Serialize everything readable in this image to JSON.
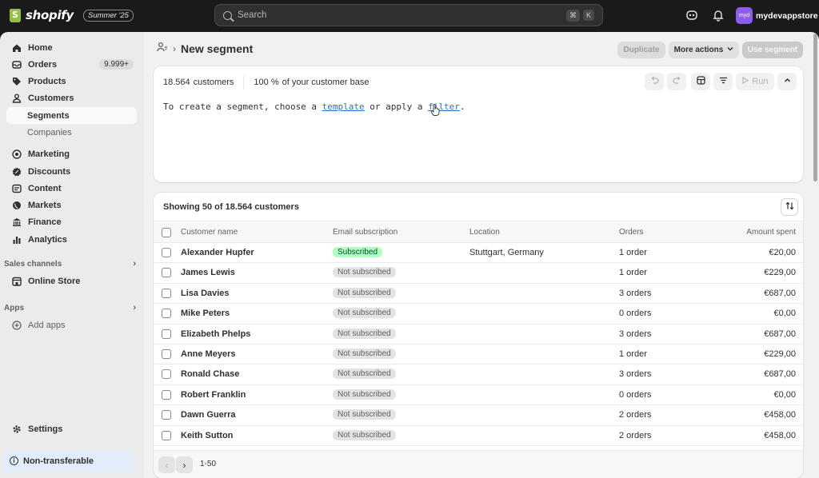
{
  "topbar": {
    "logo_text": "shopify",
    "edition_badge": "Summer '25",
    "search_placeholder": "Search",
    "shortcut_keys": [
      "⌘",
      "K"
    ],
    "store_avatar": "myd",
    "store_name": "mydevappstore"
  },
  "sidebar": {
    "items": [
      {
        "label": "Home",
        "icon": "home-icon"
      },
      {
        "label": "Orders",
        "icon": "orders-icon",
        "count": "9.999+"
      },
      {
        "label": "Products",
        "icon": "tag-icon"
      },
      {
        "label": "Customers",
        "icon": "person-icon"
      },
      {
        "label": "Segments",
        "sub": true,
        "active": true
      },
      {
        "label": "Companies",
        "sub": true
      },
      {
        "label": "Marketing",
        "icon": "target-icon"
      },
      {
        "label": "Discounts",
        "icon": "discount-icon"
      },
      {
        "label": "Content",
        "icon": "content-icon"
      },
      {
        "label": "Markets",
        "icon": "globe-icon"
      },
      {
        "label": "Finance",
        "icon": "bank-icon"
      },
      {
        "label": "Analytics",
        "icon": "chart-icon"
      }
    ],
    "sales_channels_label": "Sales channels",
    "online_store_label": "Online Store",
    "apps_label": "Apps",
    "add_apps_label": "Add apps",
    "settings_label": "Settings",
    "non_transferable_label": "Non-transferable"
  },
  "page": {
    "title": "New segment",
    "buttons": {
      "duplicate": "Duplicate",
      "more_actions": "More actions",
      "use_segment": "Use segment"
    }
  },
  "editor": {
    "customer_count": "18.564",
    "customer_count_suffix": "customers",
    "base_percent": "100 %",
    "base_suffix": "of your customer base",
    "run_label": "Run",
    "text_prefix": "To create a segment, choose a",
    "template_link": "template",
    "text_middle": "or apply a",
    "filter_link": "filter",
    "text_suffix": "."
  },
  "table": {
    "title": "Showing 50 of 18.564 customers",
    "columns": [
      "Customer name",
      "Email subscription",
      "Location",
      "Orders",
      "Amount spent"
    ],
    "rows": [
      {
        "name": "Alexander Hupfer",
        "subscription": "Subscribed",
        "location": "Stuttgart, Germany",
        "orders": "1 order",
        "amount": "€20,00"
      },
      {
        "name": "James Lewis",
        "subscription": "Not subscribed",
        "location": "",
        "orders": "1 order",
        "amount": "€229,00"
      },
      {
        "name": "Lisa Davies",
        "subscription": "Not subscribed",
        "location": "",
        "orders": "3 orders",
        "amount": "€687,00"
      },
      {
        "name": "Mike Peters",
        "subscription": "Not subscribed",
        "location": "",
        "orders": "0 orders",
        "amount": "€0,00"
      },
      {
        "name": "Elizabeth Phelps",
        "subscription": "Not subscribed",
        "location": "",
        "orders": "3 orders",
        "amount": "€687,00"
      },
      {
        "name": "Anne Meyers",
        "subscription": "Not subscribed",
        "location": "",
        "orders": "1 order",
        "amount": "€229,00"
      },
      {
        "name": "Ronald Chase",
        "subscription": "Not subscribed",
        "location": "",
        "orders": "3 orders",
        "amount": "€687,00"
      },
      {
        "name": "Robert Franklin",
        "subscription": "Not subscribed",
        "location": "",
        "orders": "0 orders",
        "amount": "€0,00"
      },
      {
        "name": "Dawn Guerra",
        "subscription": "Not subscribed",
        "location": "",
        "orders": "2 orders",
        "amount": "€458,00"
      },
      {
        "name": "Keith Sutton",
        "subscription": "Not subscribed",
        "location": "",
        "orders": "2 orders",
        "amount": "€458,00"
      }
    ],
    "pagination_label": "1-50"
  },
  "colors": {
    "topbar_bg": "#1a1a1a",
    "subscribed_badge": "#affebf",
    "link": "#2c6ecb",
    "store_avatar": "#8a5cf0"
  }
}
